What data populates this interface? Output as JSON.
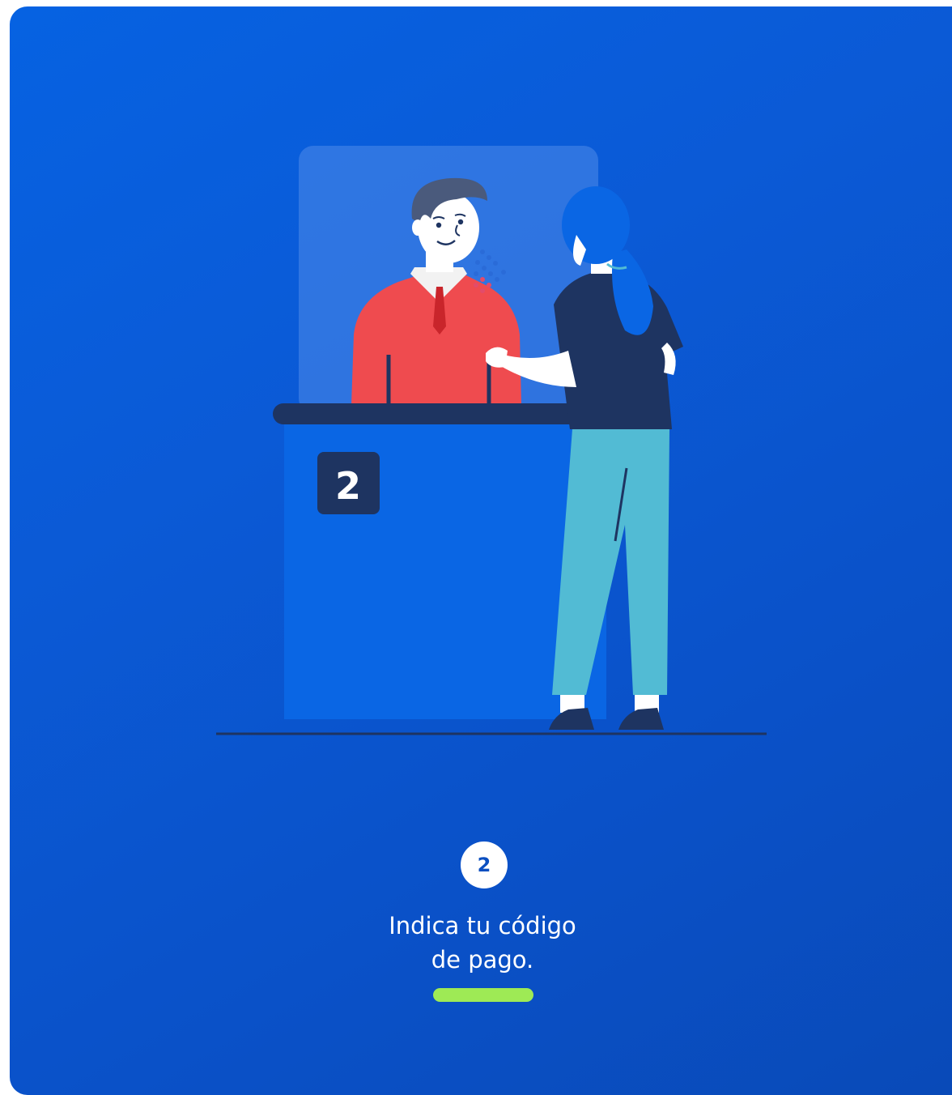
{
  "step": {
    "number": "2",
    "caption_line1": "Indica tu código",
    "caption_line2": "de pago.",
    "progress_color": "#9eea55"
  },
  "illustration": {
    "description_icon": "cashier-counter-illustration",
    "counter_sign": "2"
  },
  "colors": {
    "background": "#0b5ad6",
    "counter": "#0a63e0",
    "counter_top": "#1e3461",
    "teller_shirt": "#ef4b4f",
    "customer_pants": "#52bbd4",
    "customer_shirt": "#1e3461"
  }
}
